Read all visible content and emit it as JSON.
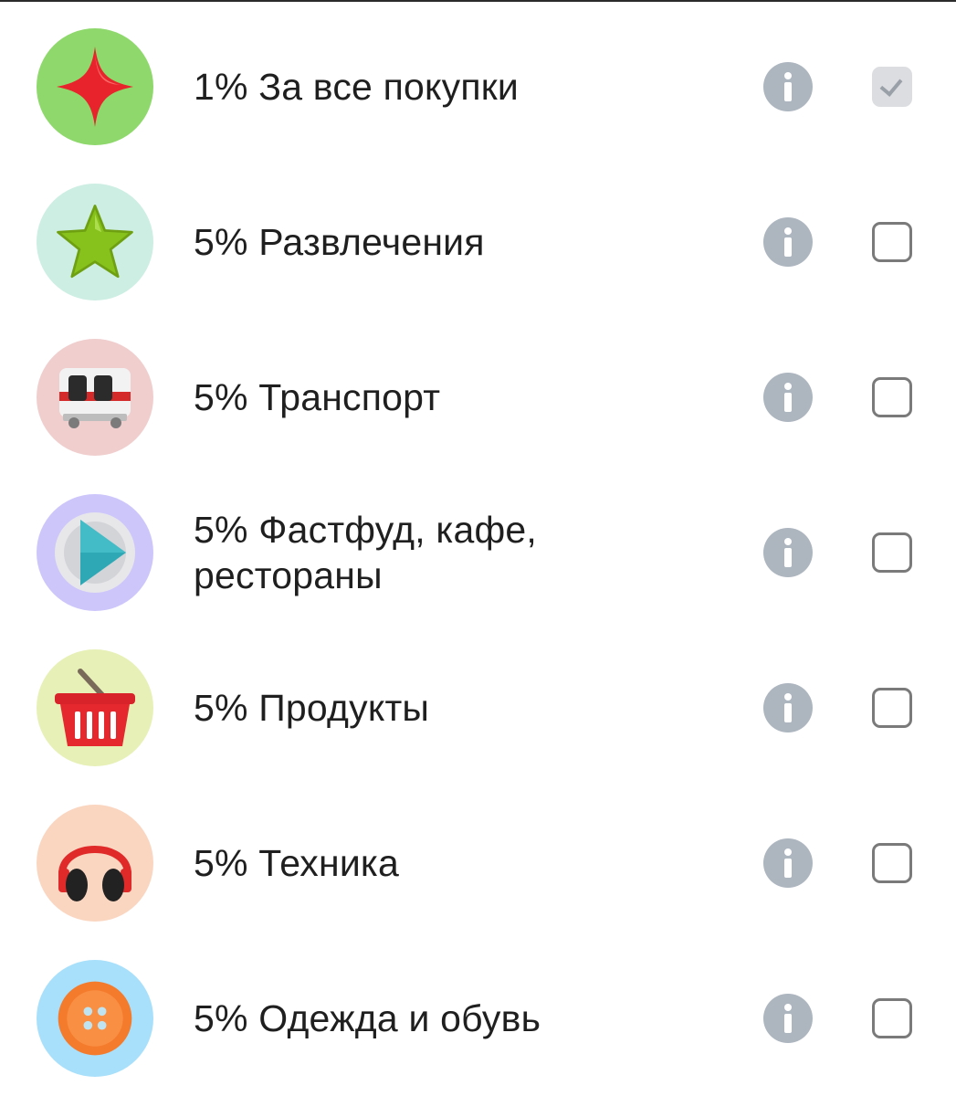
{
  "categories": [
    {
      "label": "1% За все покупки",
      "icon": "red-sparkle-star-icon",
      "icon_bg": "#8ed86c",
      "checked": true
    },
    {
      "label": "5% Развлечения",
      "icon": "green-star-icon",
      "icon_bg": "#cdeee2",
      "checked": false
    },
    {
      "label": "5% Транспорт",
      "icon": "subway-train-icon",
      "icon_bg": "#f0cece",
      "checked": false
    },
    {
      "label": "5% Фастфуд, кафе, рестораны",
      "icon": "play-plate-icon",
      "icon_bg": "#cdc6fb",
      "checked": false
    },
    {
      "label": "5% Продукты",
      "icon": "shopping-basket-icon",
      "icon_bg": "#e7f0b7",
      "checked": false
    },
    {
      "label": "5% Техника",
      "icon": "headphones-icon",
      "icon_bg": "#fad6c1",
      "checked": false
    },
    {
      "label": "5% Одежда и обувь",
      "icon": "button-icon",
      "icon_bg": "#a8e0fb",
      "checked": false
    }
  ],
  "colors": {
    "info_icon": "#adb5bf",
    "checkbox_border": "#7a7a7a",
    "checkbox_checked_bg": "#dcdde0",
    "text": "#1f1f1f"
  }
}
